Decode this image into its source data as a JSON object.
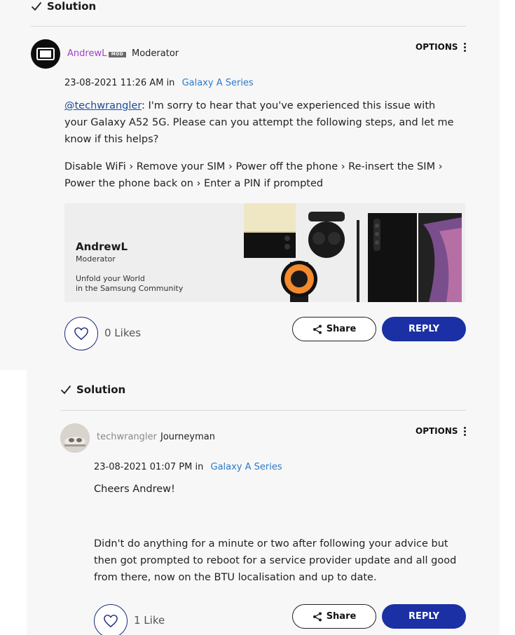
{
  "post1": {
    "solution_label": "Solution",
    "author": {
      "name": "AndrewL",
      "badge": "MOD",
      "rank": "Moderator",
      "name_color": "#a23fce"
    },
    "options_label": "OPTIONS",
    "date": "23-08-2021",
    "time": "11:26 AM",
    "in_word": "in",
    "board": "Galaxy A Series",
    "mention": "@techwrangler",
    "paragraph1_rest": ": I'm sorry to hear that you've experienced this issue with your Galaxy A52 5G. Please can you attempt the following steps, and let me know if this helps?",
    "paragraph2": "Disable WiFi › Remove your SIM › Power off the phone › Re-insert the SIM › Power the phone back on › Enter a PIN if prompted",
    "banner": {
      "name": "AndrewL",
      "role": "Moderator",
      "tagline1": "Unfold your World",
      "tagline2": "in the Samsung Community"
    },
    "likes": "0 Likes",
    "share_label": "Share",
    "reply_label": "REPLY"
  },
  "post2": {
    "solution_label": "Solution",
    "author": {
      "name": "techwrangler",
      "rank": "Journeyman",
      "name_color": "#888888"
    },
    "options_label": "OPTIONS",
    "date": "23-08-2021",
    "time": "01:07 PM",
    "in_word": "in",
    "board": "Galaxy A Series",
    "paragraph1": "Cheers Andrew!",
    "paragraph2": "Didn't do anything for a minute or two after following your advice but then got prompted to reboot for a service provider update and all good from there, now on the BTU localisation and up to date.",
    "likes": "1 Like",
    "share_label": "Share",
    "reply_label": "REPLY"
  },
  "colors": {
    "reply_button": "#1b30a5",
    "link": "#2d7ac9",
    "mention": "#1c4a9c"
  },
  "icons": [
    "checkmark-icon",
    "kebab-menu-icon",
    "heart-icon",
    "share-icon",
    "moderator-avatar-icon"
  ]
}
